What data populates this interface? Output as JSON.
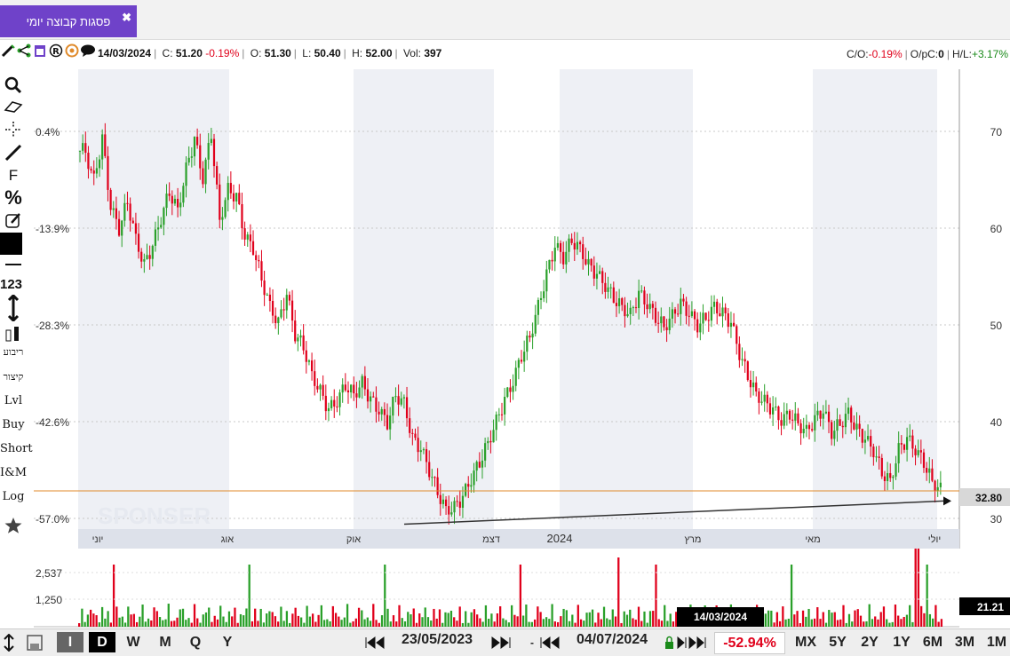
{
  "tab": {
    "title": "פסגות קבוצה יומי",
    "close": "✖"
  },
  "info": {
    "date": "14/03/2024",
    "close_label": "C:",
    "close_value": "51.20",
    "close_change": "-0.19%",
    "open_label": "O:",
    "open_value": "51.30",
    "low_label": "L:",
    "low_value": "50.40",
    "high_label": "H:",
    "high_value": "52.00",
    "vol_label": "Vol:",
    "vol_value": "397",
    "co_label": "C/O:",
    "co_value": "-0.19%",
    "opc_label": "O/pC:",
    "opc_value": "0",
    "hl_label": "H/L:",
    "hl_value": "+3.17%"
  },
  "left_tools": {
    "lvl": "Lvl",
    "buy": "Buy",
    "short": "Short",
    "im": "I&M",
    "log": "Log",
    "num": "123",
    "f": "F",
    "pct": "%",
    "rtl1": "ריבוע",
    "rtl2": "קיצור"
  },
  "colors": {
    "up": "#2aa02a",
    "down": "#e0001b",
    "purple": "#6f42c9",
    "hline": "#e08a2a",
    "band": "#eef0f5"
  },
  "chart_data": {
    "type": "candlestick",
    "pct_labels": [
      "0.4%",
      "-13.9%",
      "-28.3%",
      "-42.6%",
      "-57.0%"
    ],
    "price_ticks": [
      70,
      60,
      50,
      40,
      30
    ],
    "month_labels": [
      "יוני",
      "אוג",
      "אוק",
      "דצמ",
      "2024",
      "מרץ",
      "מאי",
      "יולי"
    ],
    "current_price": "32.80",
    "volume_ticks": [
      "2,537",
      "1,250"
    ],
    "volume_current": "21.21",
    "cursor_date": "14/03/2024",
    "watermark": "SPONSER",
    "closes": [
      68,
      65,
      69,
      62,
      60,
      63,
      59,
      56,
      58,
      61,
      64,
      62,
      66,
      69,
      65,
      70,
      61,
      64,
      63,
      59,
      58,
      55,
      52,
      50,
      53,
      49,
      48,
      45,
      43,
      41,
      42,
      44,
      43,
      44,
      42,
      41,
      40,
      43,
      42,
      38,
      37,
      35,
      33,
      31,
      31,
      32,
      34,
      36,
      38,
      40,
      42,
      44,
      47,
      49,
      52,
      55,
      58,
      57,
      59,
      58,
      56,
      55,
      54,
      53,
      52,
      51,
      53,
      52,
      51,
      50,
      51,
      52,
      51,
      50,
      51,
      52,
      51,
      50,
      47,
      45,
      43,
      42,
      41,
      40,
      41,
      40,
      39,
      40,
      41,
      39,
      40,
      41,
      39,
      38,
      37,
      35,
      34,
      37,
      38,
      37,
      36,
      34,
      33
    ],
    "trendline": {
      "from": 29.4,
      "to": 31.8
    },
    "range": {
      "from": "23/05/2023",
      "to": "04/07/2024",
      "change": "-52.94%"
    }
  },
  "bottom": {
    "btn_i": "I",
    "btn_d": "D",
    "btn_w": "W",
    "btn_m": "M",
    "btn_q": "Q",
    "btn_y": "Y",
    "mx": "MX",
    "y5": "5Y",
    "y2": "2Y",
    "y1": "1Y",
    "m6": "6M",
    "m3": "3M",
    "m1": "1M"
  }
}
